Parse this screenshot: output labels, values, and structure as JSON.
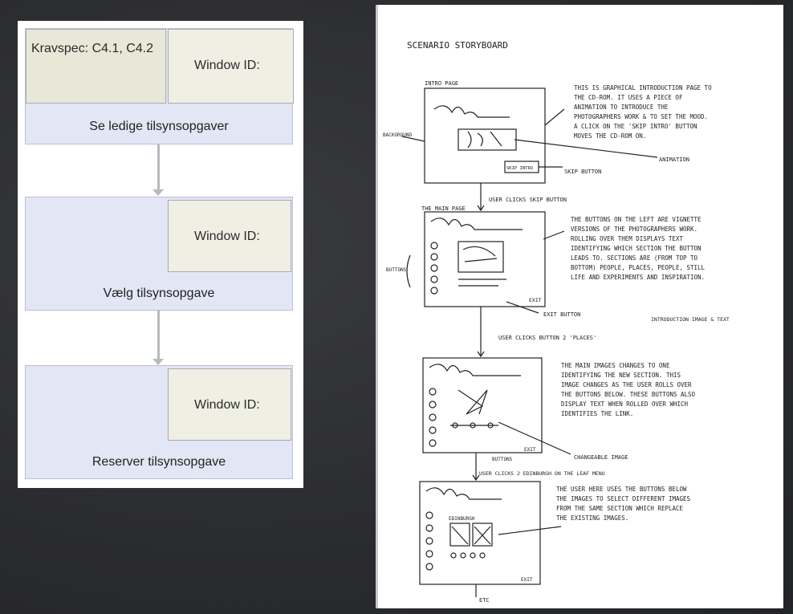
{
  "flow": {
    "box1": {
      "spec": "Kravspec: C4.1, C4.2",
      "window_id": "Window ID:",
      "label": "Se ledige tilsynsopgaver"
    },
    "box2": {
      "window_id": "Window ID:",
      "label": "Vælg tilsynsopgave"
    },
    "box3": {
      "window_id": "Window ID:",
      "label": "Reserver tilsynsopgave"
    }
  },
  "storyboard": {
    "title": "SCENARIO STORYBOARD",
    "frame1": {
      "label": "INTRO PAGE",
      "note": "THIS IS GRAPHICAL INTRODUCTION PAGE TO THE CD-ROM. IT USES A PIECE OF ANIMATION TO INTRODUCE THE PHOTOGRAPHERS WORK & TO SET THE MOOD. A CLICK ON THE 'SKIP INTRO' BUTTON MOVES THE CD-ROM ON.",
      "skip": "SKIP INTRO",
      "skip_btn": "SKIP BUTTON",
      "animation": "ANIMATION",
      "bg": "BACKGROUND",
      "action": "USER CLICKS SKIP BUTTON"
    },
    "frame2": {
      "label": "THE MAIN PAGE",
      "note": "THE BUTTONS ON THE LEFT ARE VIGNETTE VERSIONS OF THE PHOTOGRAPHERS WORK. ROLLING OVER THEM DISPLAYS TEXT IDENTIFYING WHICH SECTION THE BUTTON LEADS TO. SECTIONS ARE (FROM TOP TO BOTTOM) PEOPLE, PLACES, PEOPLE, STILL LIFE AND EXPERIMENTS AND INSPIRATION.",
      "buttons": "BUTTONS",
      "exit": "EXIT",
      "exit_btn": "EXIT BUTTON",
      "intro": "INTRODUCTION IMAGE & TEXT",
      "action": "USER CLICKS BUTTON 2 'PLACES'"
    },
    "frame3": {
      "note": "THE MAIN IMAGES CHANGES TO ONE IDENTIFYING THE NEW SECTION. THIS IMAGE CHANGES AS THE USER ROLLS OVER THE BUTTONS BELOW. THESE BUTTONS ALSO DISPLAY TEXT WHEN ROLLED OVER WHICH IDENTIFIES THE LINK.",
      "changeable": "CHANGEABLE IMAGE",
      "buttons": "BUTTONS",
      "exit": "EXIT",
      "action": "USER CLICKS 2 EDINBURGH ON THE LEAF MENU"
    },
    "frame4": {
      "note": "THE USER HERE USES THE BUTTONS BELOW THE IMAGES TO SELECT DIFFERENT IMAGES FROM THE SAME SECTION WHICH REPLACE THE EXISTING IMAGES.",
      "edinburgh": "EDINBURGH",
      "exit": "EXIT",
      "bottom": "ETC"
    }
  }
}
